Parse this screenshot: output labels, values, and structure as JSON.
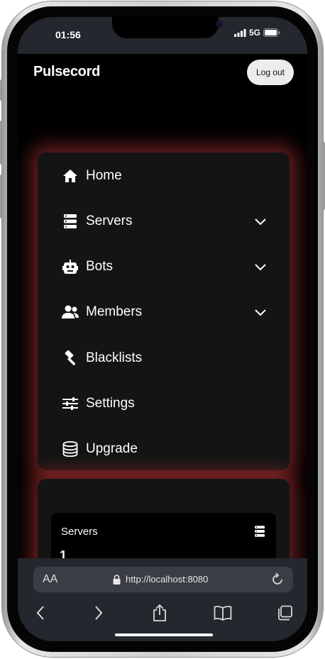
{
  "status_bar": {
    "time": "01:56",
    "network": "5G"
  },
  "header": {
    "brand": "Pulsecord",
    "logout_label": "Log out"
  },
  "nav": {
    "items": [
      {
        "label": "Home",
        "icon": "home-icon",
        "expandable": false
      },
      {
        "label": "Servers",
        "icon": "server-icon",
        "expandable": true
      },
      {
        "label": "Bots",
        "icon": "robot-icon",
        "expandable": true
      },
      {
        "label": "Members",
        "icon": "users-icon",
        "expandable": true
      },
      {
        "label": "Blacklists",
        "icon": "gavel-icon",
        "expandable": false
      },
      {
        "label": "Settings",
        "icon": "sliders-icon",
        "expandable": false
      },
      {
        "label": "Upgrade",
        "icon": "coins-icon",
        "expandable": false
      }
    ]
  },
  "stats": {
    "servers_title": "Servers",
    "servers_value": "1"
  },
  "browser": {
    "text_size_label": "AA",
    "url": "http://localhost:8080"
  },
  "colors": {
    "glow": "#be3737",
    "card": "#141414",
    "browser_bar": "#24272d",
    "background": "#000000"
  }
}
